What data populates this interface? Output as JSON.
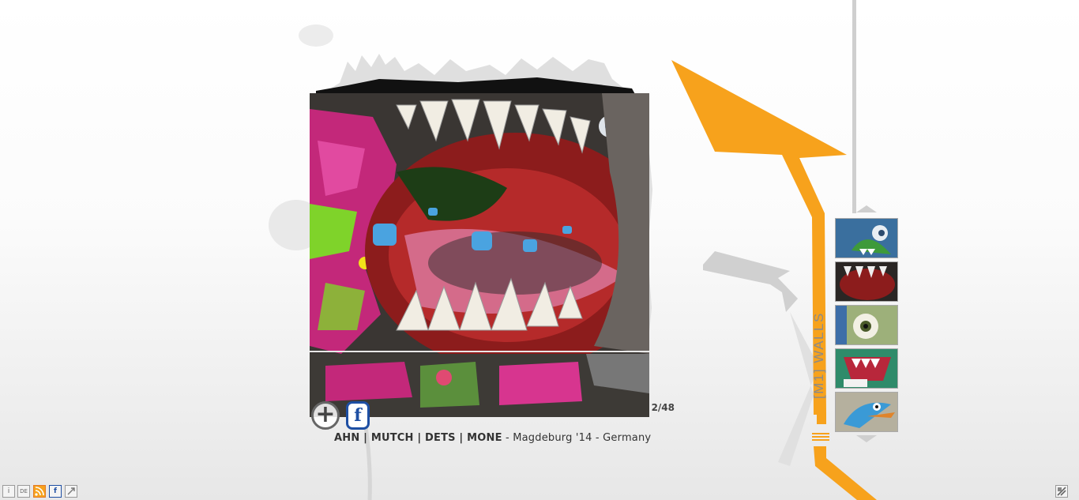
{
  "artwork": {
    "counter": "2/48",
    "artists": "AHN | MUTCH | DETS | MONE",
    "details": " - Magdeburg '14 - Germany"
  },
  "section": {
    "label": "[M1] WALLS"
  },
  "controls": {
    "zoom_icon": "plus-circle-icon",
    "share_icon": "facebook-share-icon"
  },
  "toolbar": {
    "info_label": "i",
    "language_label": "DE",
    "rss_icon": "rss-icon",
    "facebook_label": "f",
    "fullscreen_icon": "fullscreen-icon",
    "settings_icon": "settings-icon"
  },
  "colors": {
    "accent_orange": "#f7a21c",
    "grey_shape": "#cfcfcf",
    "share_blue": "#1e4fa3"
  }
}
